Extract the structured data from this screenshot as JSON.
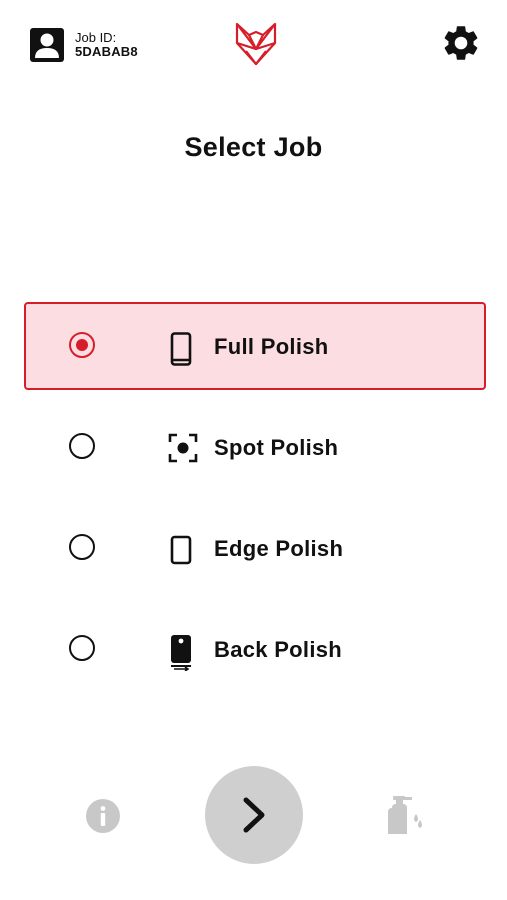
{
  "header": {
    "job_id_label": "Job ID:",
    "job_id_value": "5DABAB8",
    "user_icon": "user-account-icon",
    "logo_icon": "fox-logo-icon",
    "settings_icon": "gear-icon"
  },
  "page": {
    "title": "Select Job"
  },
  "jobs": [
    {
      "label": "Full Polish",
      "icon": "phone-icon",
      "selected": true
    },
    {
      "label": "Spot Polish",
      "icon": "spot-target-icon",
      "selected": false
    },
    {
      "label": "Edge Polish",
      "icon": "phone-outline-icon",
      "selected": false
    },
    {
      "label": "Back Polish",
      "icon": "phone-back-icon",
      "selected": false
    }
  ],
  "footer": {
    "info_icon": "info-icon",
    "next_icon": "chevron-right-icon",
    "spray_icon": "spray-bottle-icon"
  },
  "colors": {
    "accent": "#d61e2a",
    "selected_background": "#fcdde2",
    "disabled_icon": "#c8c8c8",
    "next_button": "#cfcfcf"
  }
}
